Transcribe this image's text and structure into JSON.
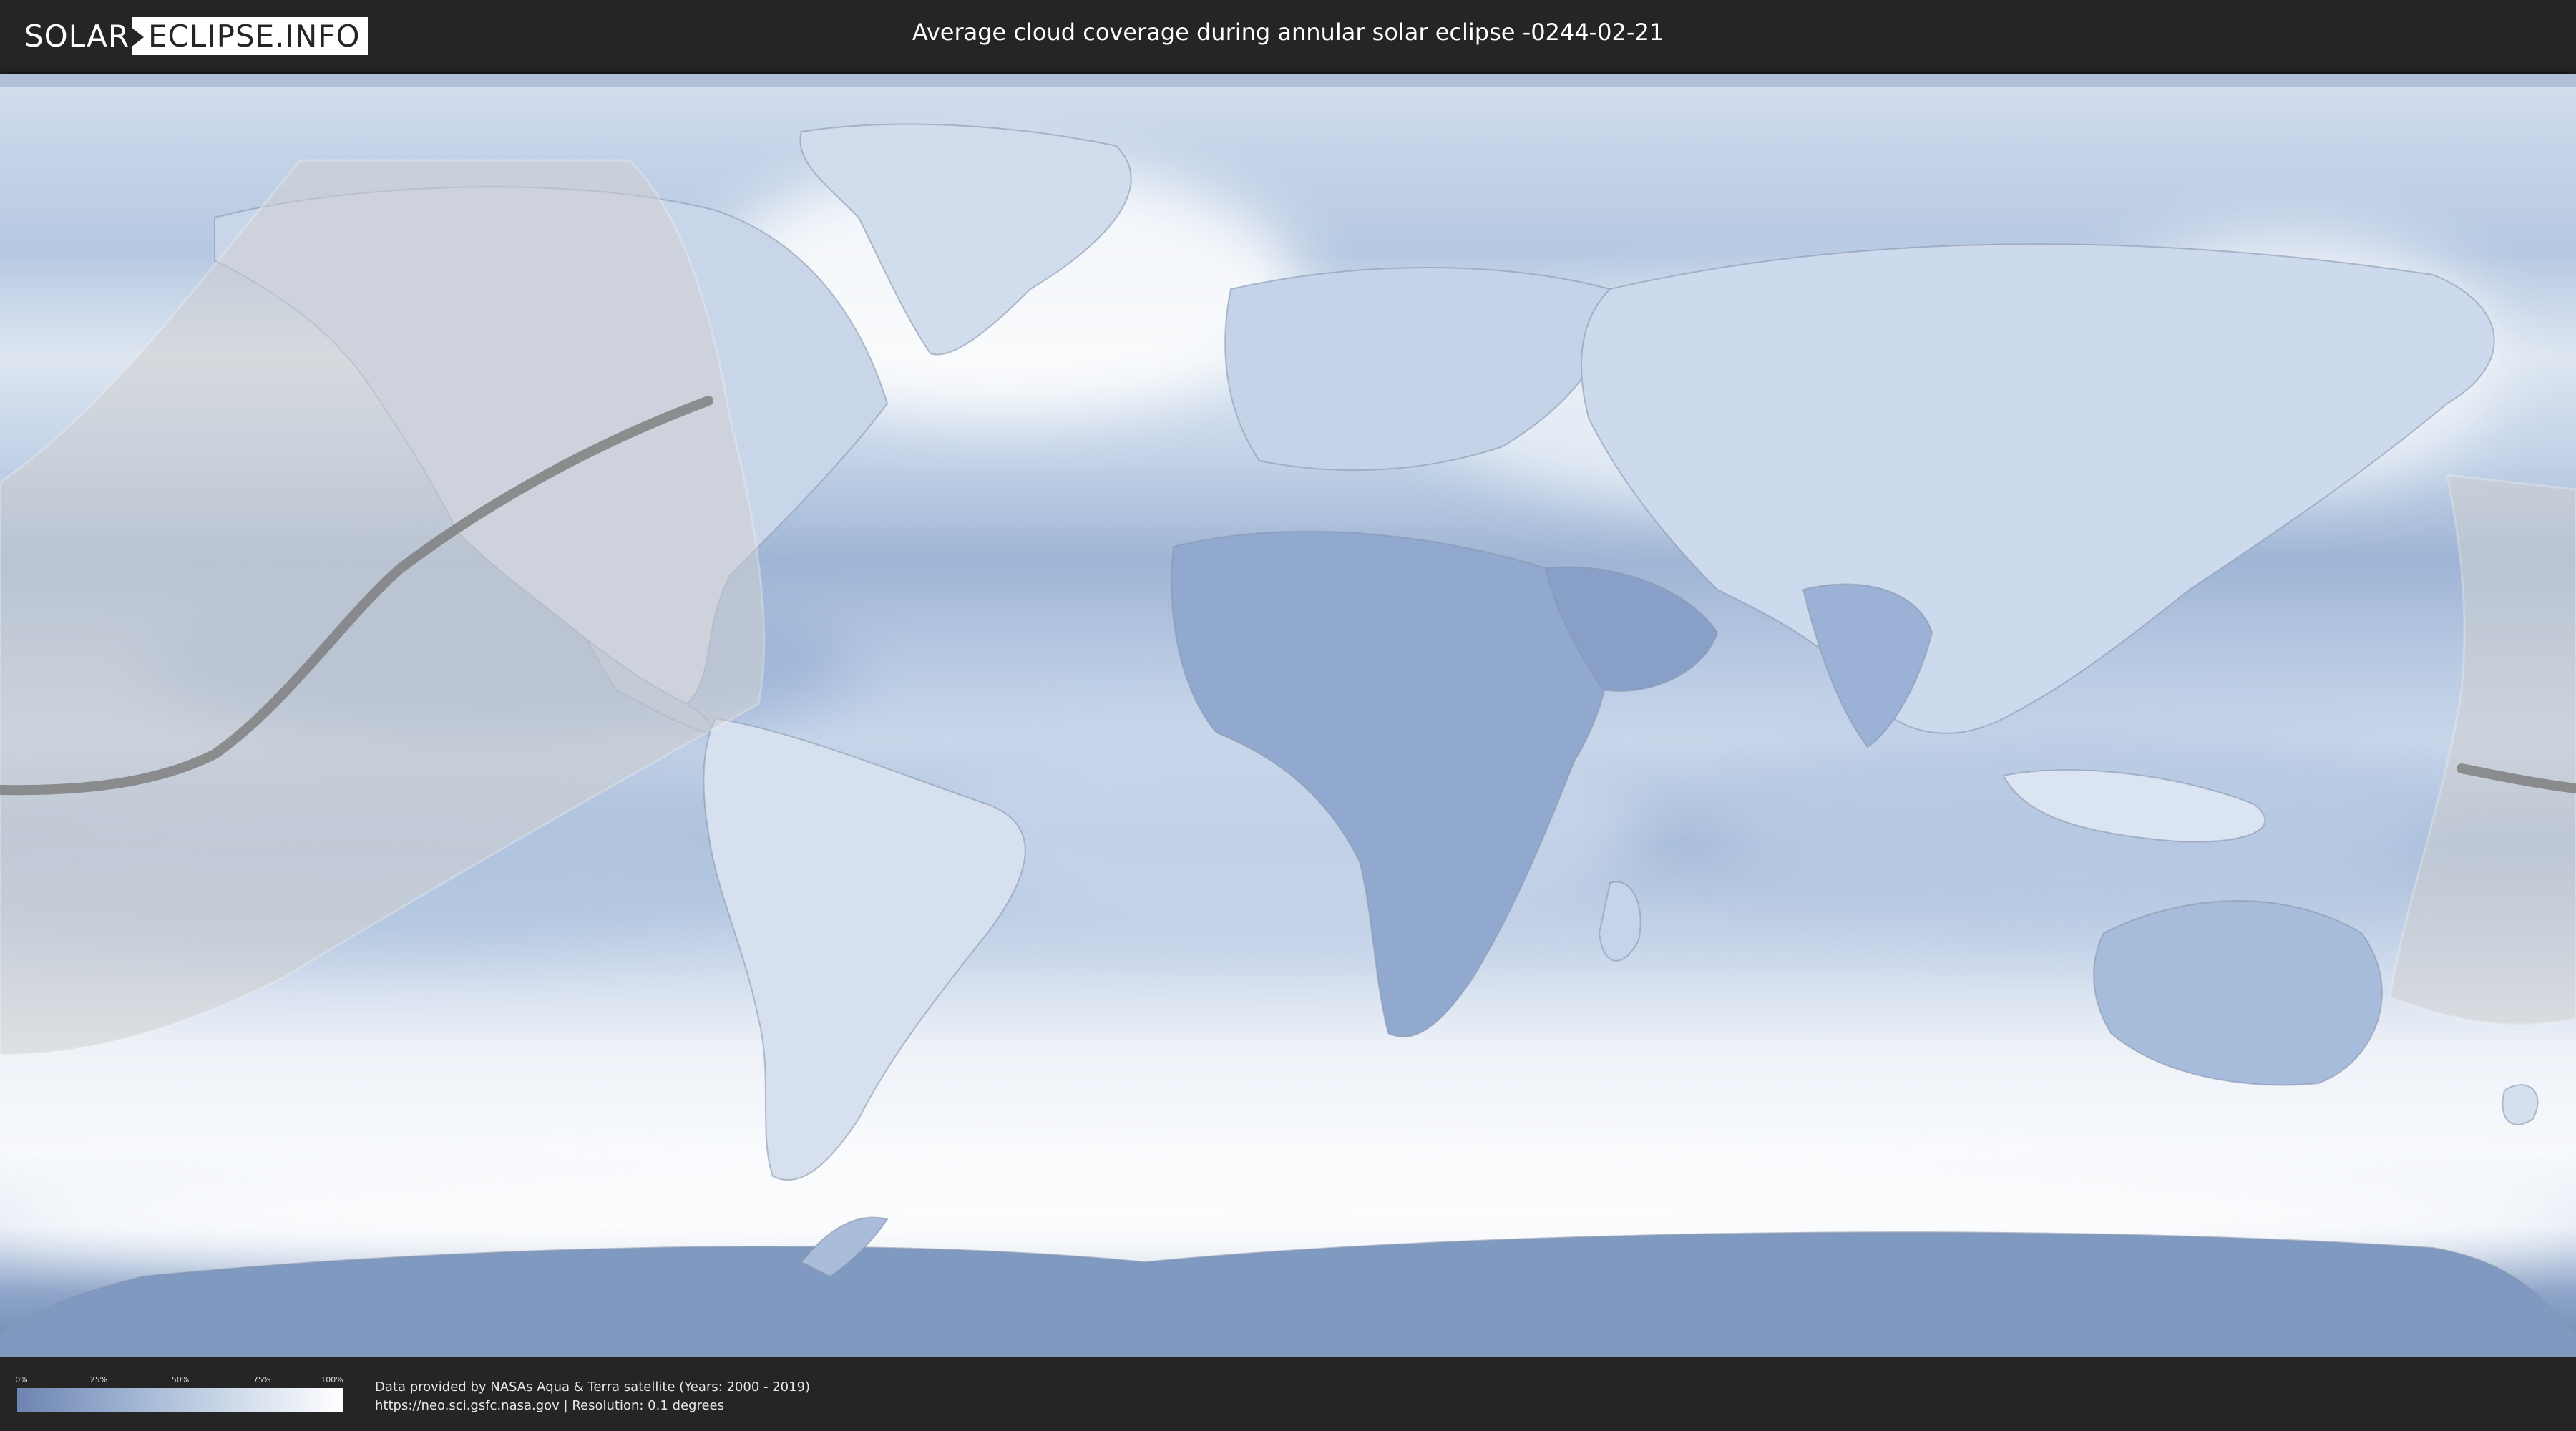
{
  "header": {
    "logo_left": "SOLAR",
    "logo_right": "ECLIPSE.INFO",
    "title": "Average cloud coverage during annular solar eclipse -0244-02-21"
  },
  "map": {
    "projection": "equirectangular",
    "colors": {
      "clear_sky": "#6c8ab6",
      "full_cloud": "#ffffff",
      "eclipse_region": "#cfcfcf",
      "central_line": "#7a7a7a",
      "coastline": "#8090a8"
    },
    "eclipse_path": {
      "type": "annular",
      "date": "-0244-02-21"
    }
  },
  "legend": {
    "labels": [
      "0%",
      "25%",
      "50%",
      "75%",
      "100%"
    ]
  },
  "footer": {
    "credit_line": "Data provided by NASAs Aqua & Terra satellite (Years: 2000 - 2019)",
    "source_line": "https://neo.sci.gsfc.nasa.gov | Resolution: 0.1 degrees"
  }
}
